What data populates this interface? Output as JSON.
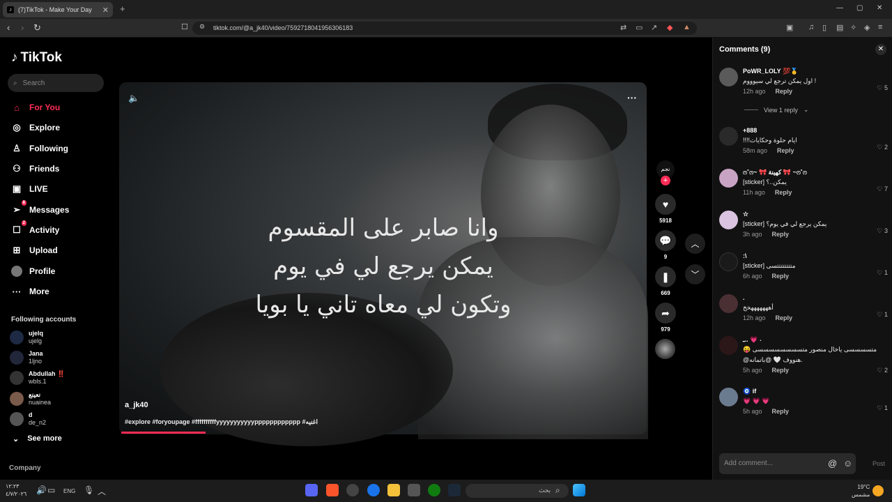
{
  "browser": {
    "tab_title": "(7)TikTok - Make Your Day",
    "url": "tiktok.com/@a_jk40/video/7592718041956306183"
  },
  "sidebar": {
    "logo": "TikTok",
    "search_placeholder": "Search",
    "nav": [
      {
        "label": "For You",
        "icon": "home-icon"
      },
      {
        "label": "Explore",
        "icon": "compass-icon"
      },
      {
        "label": "Following",
        "icon": "user-follow-icon"
      },
      {
        "label": "Friends",
        "icon": "friends-icon"
      },
      {
        "label": "LIVE",
        "icon": "live-icon"
      },
      {
        "label": "Messages",
        "icon": "paper-plane-icon",
        "badge": "8"
      },
      {
        "label": "Activity",
        "icon": "activity-icon",
        "badge": "2"
      },
      {
        "label": "Upload",
        "icon": "plus-square-icon"
      },
      {
        "label": "Profile",
        "icon": "profile-avatar"
      },
      {
        "label": "More",
        "icon": "ellipsis-icon"
      }
    ],
    "following_title": "Following accounts",
    "accounts": [
      {
        "name": "ujelq",
        "handle": "ujelg"
      },
      {
        "name": "Jana",
        "handle": "1ljno"
      },
      {
        "name": "Abdullah ‼️",
        "handle": "wbls.1"
      },
      {
        "name": "نعينع",
        "handle": "nuainea"
      },
      {
        "name": "d",
        "handle": "de_n2"
      }
    ],
    "see_more": "See more",
    "company": "Company"
  },
  "video": {
    "lyrics": [
      "وانا صابر على المقسوم",
      "يمكن يرجع لي في يوم",
      "وتكون لي معاه تاني يا بويا"
    ],
    "author": "a_jk40",
    "caption": "#explore #foryoupage #ffffffffffyyyyyyyyyyypppppppppppp #اغنيه",
    "progress": 0.16
  },
  "actions": {
    "author_label": "نجم",
    "likes": "5918",
    "comments": "9",
    "saves": "669",
    "shares": "979"
  },
  "comments": {
    "title": "Comments (9)",
    "view_reply": "View 1 reply",
    "placeholder": "Add comment...",
    "post": "Post",
    "items": [
      {
        "user": "PoWR_LOLY 💯🥇",
        "text": "اول يمكن ترجع لي سيوووم !",
        "time": "12h ago",
        "reply": "Reply",
        "likes": "5",
        "avatar_color": "#555"
      },
      {
        "user": "+888",
        "text": "!!!!ايام حلوة وحكايات",
        "time": "58m ago",
        "reply": "Reply",
        "likes": "2",
        "avatar_color": "#2a2a2a"
      },
      {
        "user": "ෆ˚ෆ~ 🎀 كهينة 🎀 ~ෆ˚ෆ",
        "text": "[sticker] يمكن..؟",
        "time": "11h ago",
        "reply": "Reply",
        "likes": "7",
        "avatar_color": "#c9a3c4"
      },
      {
        "user": "☆",
        "text": "[sticker] يمكن يرجع لي في يوم؟",
        "time": "3h ago",
        "reply": "Reply",
        "likes": "3",
        "avatar_color": "#d9c3e0"
      },
      {
        "user": ":\\",
        "text": "[sticker] متتتتتتتتسى",
        "time": "6h ago",
        "reply": "Reply",
        "likes": "1",
        "avatar_color": "#1a1a1a"
      },
      {
        "user": ".",
        "text": "أهههههههخخ",
        "time": "12h ago",
        "reply": "Reply",
        "likes": "1",
        "avatar_color": "#4a2f33"
      },
      {
        "user": "ـ.. 💗 ˖",
        "text": "😝 متسسسسى ياخال منصور متسسسسسسسسى",
        "text2": "@هنووف 🤍 @باتمانه.",
        "time": "5h ago",
        "reply": "Reply",
        "likes": "2",
        "avatar_color": "#2b1618"
      },
      {
        "user": "🧿 if",
        "text": "💗 💗 💗",
        "time": "5h ago",
        "reply": "Reply",
        "likes": "1",
        "avatar_color": "#6b7b8f"
      }
    ]
  },
  "taskbar": {
    "time": "١٢:٢٣",
    "date": "٤/٧/٢٠٢٦",
    "lang": "ENG",
    "search": "بحث",
    "weather": "19°C",
    "weather_desc": "مشمس"
  }
}
